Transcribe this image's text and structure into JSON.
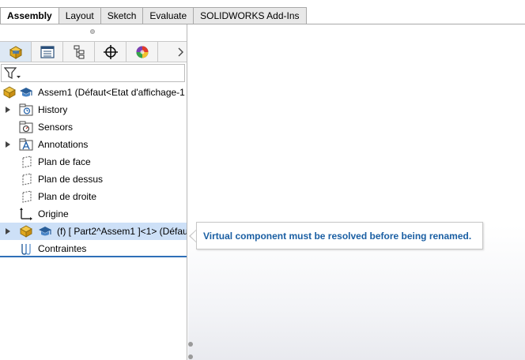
{
  "tabs": [
    {
      "label": "Assembly",
      "active": true
    },
    {
      "label": "Layout",
      "active": false
    },
    {
      "label": "Sketch",
      "active": false
    },
    {
      "label": "Evaluate",
      "active": false
    },
    {
      "label": "SOLIDWORKS Add-Ins",
      "active": false
    }
  ],
  "manager_tabs": [
    "featuremanager-icon",
    "propertymanager-icon",
    "configurationmanager-icon",
    "dimxpertmanager-icon",
    "displaymanager-icon"
  ],
  "filter_icon": "funnel-icon",
  "tree": {
    "root_label": "Assem1  (Défaut<Etat d'affichage-1",
    "items": [
      {
        "label": "History",
        "icon": "history-folder-icon",
        "expandable": true
      },
      {
        "label": "Sensors",
        "icon": "sensors-folder-icon",
        "expandable": false
      },
      {
        "label": "Annotations",
        "icon": "annotations-folder-icon",
        "expandable": true
      },
      {
        "label": "Plan de face",
        "icon": "plane-icon",
        "expandable": false
      },
      {
        "label": "Plan de dessus",
        "icon": "plane-icon",
        "expandable": false
      },
      {
        "label": "Plan de droite",
        "icon": "plane-icon",
        "expandable": false
      },
      {
        "label": "Origine",
        "icon": "origin-icon",
        "expandable": false
      },
      {
        "label": "(f) [ Part2^Assem1 ]<1> (Défau",
        "icon": "virtual-part-icon",
        "expandable": true,
        "selected": true
      },
      {
        "label": "Contraintes",
        "icon": "mates-icon",
        "expandable": false
      }
    ]
  },
  "tooltip": {
    "message": "Virtual component must be resolved before being renamed."
  },
  "colors": {
    "tooltip_text": "#1b5fa3",
    "selection": "#cde0f7",
    "tree_end_line": "#2e6fb8"
  }
}
